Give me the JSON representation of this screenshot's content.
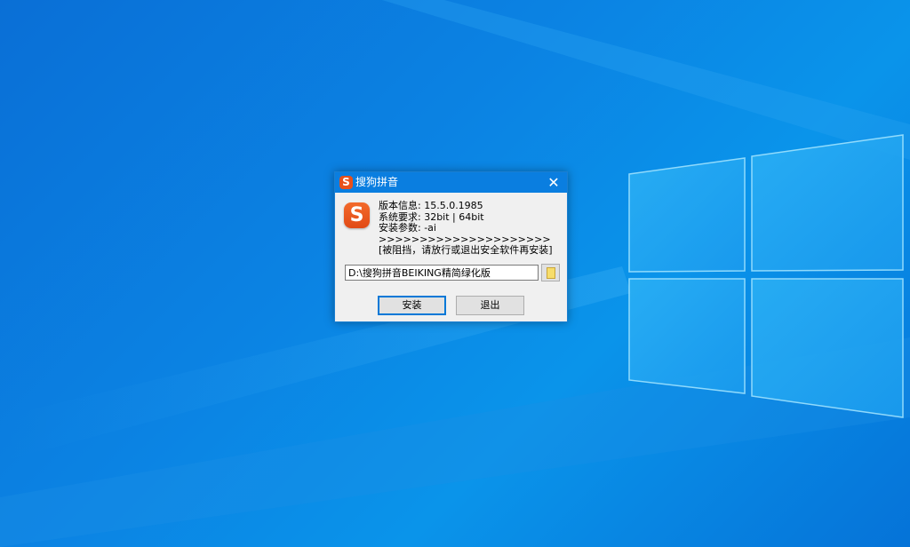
{
  "dialog": {
    "title": "搜狗拼音",
    "close_glyph": "✕",
    "logo_glyph": "S",
    "info": {
      "version": "版本信息: 15.5.0.1985",
      "requirement": "系统要求: 32bit | 64bit",
      "params": "安装参数: -ai",
      "arrows": ">>>>>>>>>>>>>>>>>>>>>",
      "warning": "[被阻挡，请放行或退出安全软件再安装]"
    },
    "path_value": "D:\\搜狗拼音BEIKING精简绿化版",
    "install_label": "安装",
    "exit_label": "退出"
  },
  "colors": {
    "titlebar": "#0a7ee0",
    "logo": "#e8501a",
    "accent": "#0078d7"
  }
}
